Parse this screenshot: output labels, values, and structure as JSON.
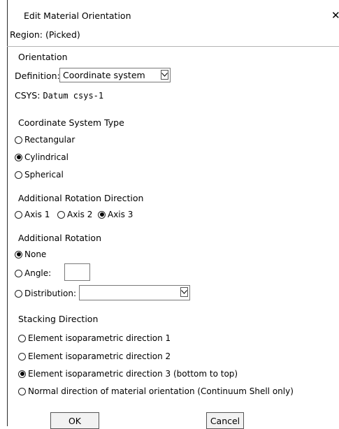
{
  "window": {
    "title": "Edit Material Orientation",
    "close_glyph": "✕"
  },
  "region": {
    "label": "Region:",
    "value": "(Picked)"
  },
  "orientation": {
    "heading": "Orientation",
    "definition_label": "Definition:",
    "definition_value": "Coordinate system",
    "csys_label": "CSYS:",
    "csys_value": "Datum csys-1"
  },
  "coord_type": {
    "heading": "Coordinate System Type",
    "options": [
      "Rectangular",
      "Cylindrical",
      "Spherical"
    ],
    "selected": "Cylindrical"
  },
  "rotation_direction": {
    "heading": "Additional Rotation Direction",
    "options": [
      "Axis 1",
      "Axis 2",
      "Axis 3"
    ],
    "selected": "Axis 3"
  },
  "additional_rotation": {
    "heading": "Additional Rotation",
    "none_label": "None",
    "angle_label": "Angle:",
    "angle_value": "",
    "distribution_label": "Distribution:",
    "distribution_value": "",
    "selected": "None"
  },
  "stacking": {
    "heading": "Stacking Direction",
    "options": [
      "Element isoparametric direction 1",
      "Element isoparametric direction 2",
      "Element isoparametric direction 3 (bottom to top)",
      "Normal direction of material orientation (Continuum Shell only)"
    ],
    "selected": "Element isoparametric direction 3 (bottom to top)"
  },
  "buttons": {
    "ok": "OK",
    "cancel": "Cancel"
  }
}
